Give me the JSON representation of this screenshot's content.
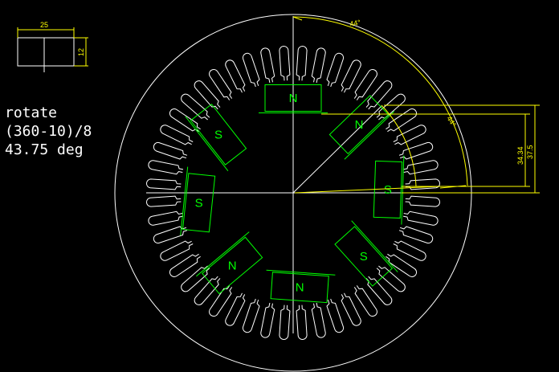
{
  "notes": [
    "rotate",
    "(360-10)/8",
    "43.75 deg"
  ],
  "ref_rect": {
    "width_label": "25",
    "height_label": "12"
  },
  "dimensions": {
    "angle_large": "44°",
    "angle_small": "44°",
    "height_inner": "34.34",
    "height_outer": "37.5"
  },
  "stator": {
    "slot_count": 48
  },
  "rotor": {
    "magnets": [
      {
        "label": "N",
        "angle_deg": 90
      },
      {
        "label": "N",
        "angle_deg": 46
      },
      {
        "label": "S",
        "angle_deg": 2
      },
      {
        "label": "S",
        "angle_deg": -42
      },
      {
        "label": "N",
        "angle_deg": -86
      },
      {
        "label": "N",
        "angle_deg": -130
      },
      {
        "label": "S",
        "angle_deg": -174
      },
      {
        "label": "S",
        "angle_deg": 142
      }
    ]
  },
  "colors": {
    "background": "#000000",
    "lines": "#ffffff",
    "dimensions": "#ffff00",
    "magnets": "#00ff00"
  }
}
